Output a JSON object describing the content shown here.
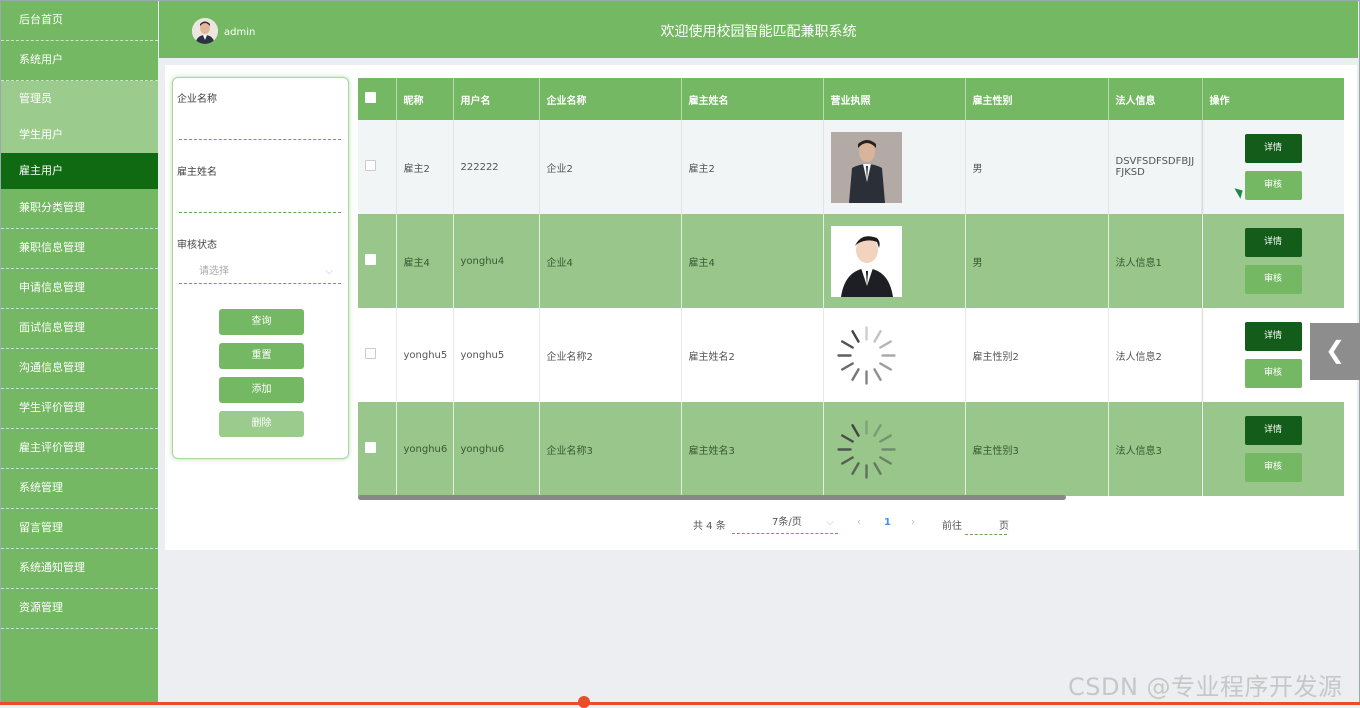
{
  "header": {
    "admin_name": "admin",
    "site_title": "欢迎使用校园智能匹配兼职系统"
  },
  "sidebar": {
    "items": [
      {
        "label": "后台首页"
      },
      {
        "label": "系统用户"
      },
      {
        "label": "管理员"
      },
      {
        "label": "学生用户"
      },
      {
        "label": "雇主用户"
      },
      {
        "label": "兼职分类管理"
      },
      {
        "label": "兼职信息管理"
      },
      {
        "label": "申请信息管理"
      },
      {
        "label": "面试信息管理"
      },
      {
        "label": "沟通信息管理"
      },
      {
        "label": "学生评价管理"
      },
      {
        "label": "雇主评价管理"
      },
      {
        "label": "系统管理"
      },
      {
        "label": "留言管理"
      },
      {
        "label": "系统通知管理"
      },
      {
        "label": "资源管理"
      }
    ]
  },
  "search": {
    "company_label": "企业名称",
    "employer_label": "雇主姓名",
    "status_label": "审核状态",
    "status_placeholder": "请选择",
    "query_button": "查询",
    "reset_button": "重置",
    "add_button": "添加",
    "delete_button": "删除"
  },
  "table": {
    "headers": [
      "昵称",
      "用户名",
      "企业名称",
      "雇主姓名",
      "营业执照",
      "雇主性别",
      "法人信息",
      "操作"
    ],
    "rows": [
      {
        "nickname": "雇主2",
        "username": "222222",
        "company": "企业2",
        "employer": "雇主2",
        "gender": "男",
        "legal": "DSVFSDFSDFBJJFJKSD"
      },
      {
        "nickname": "雇主4",
        "username": "yonghu4",
        "company": "企业4",
        "employer": "雇主4",
        "gender": "男",
        "legal": "法人信息1"
      },
      {
        "nickname": "yonghu5",
        "username": "yonghu5",
        "company": "企业名称2",
        "employer": "雇主姓名2",
        "gender": "雇主性别2",
        "legal": "法人信息2"
      },
      {
        "nickname": "yonghu6",
        "username": "yonghu6",
        "company": "企业名称3",
        "employer": "雇主姓名3",
        "gender": "雇主性别3",
        "legal": "法人信息3"
      }
    ],
    "detail_button": "详情",
    "audit_button": "审核"
  },
  "pagination": {
    "total": "共 4 条",
    "page_size": "7条/页",
    "current_page": "1",
    "goto_label": "前往",
    "page_suffix": "页"
  },
  "watermark": "CSDN @专业程序开发源",
  "colors": {
    "primary": "#74b863",
    "dark": "#0f6a12",
    "light": "#9ccb8e"
  }
}
